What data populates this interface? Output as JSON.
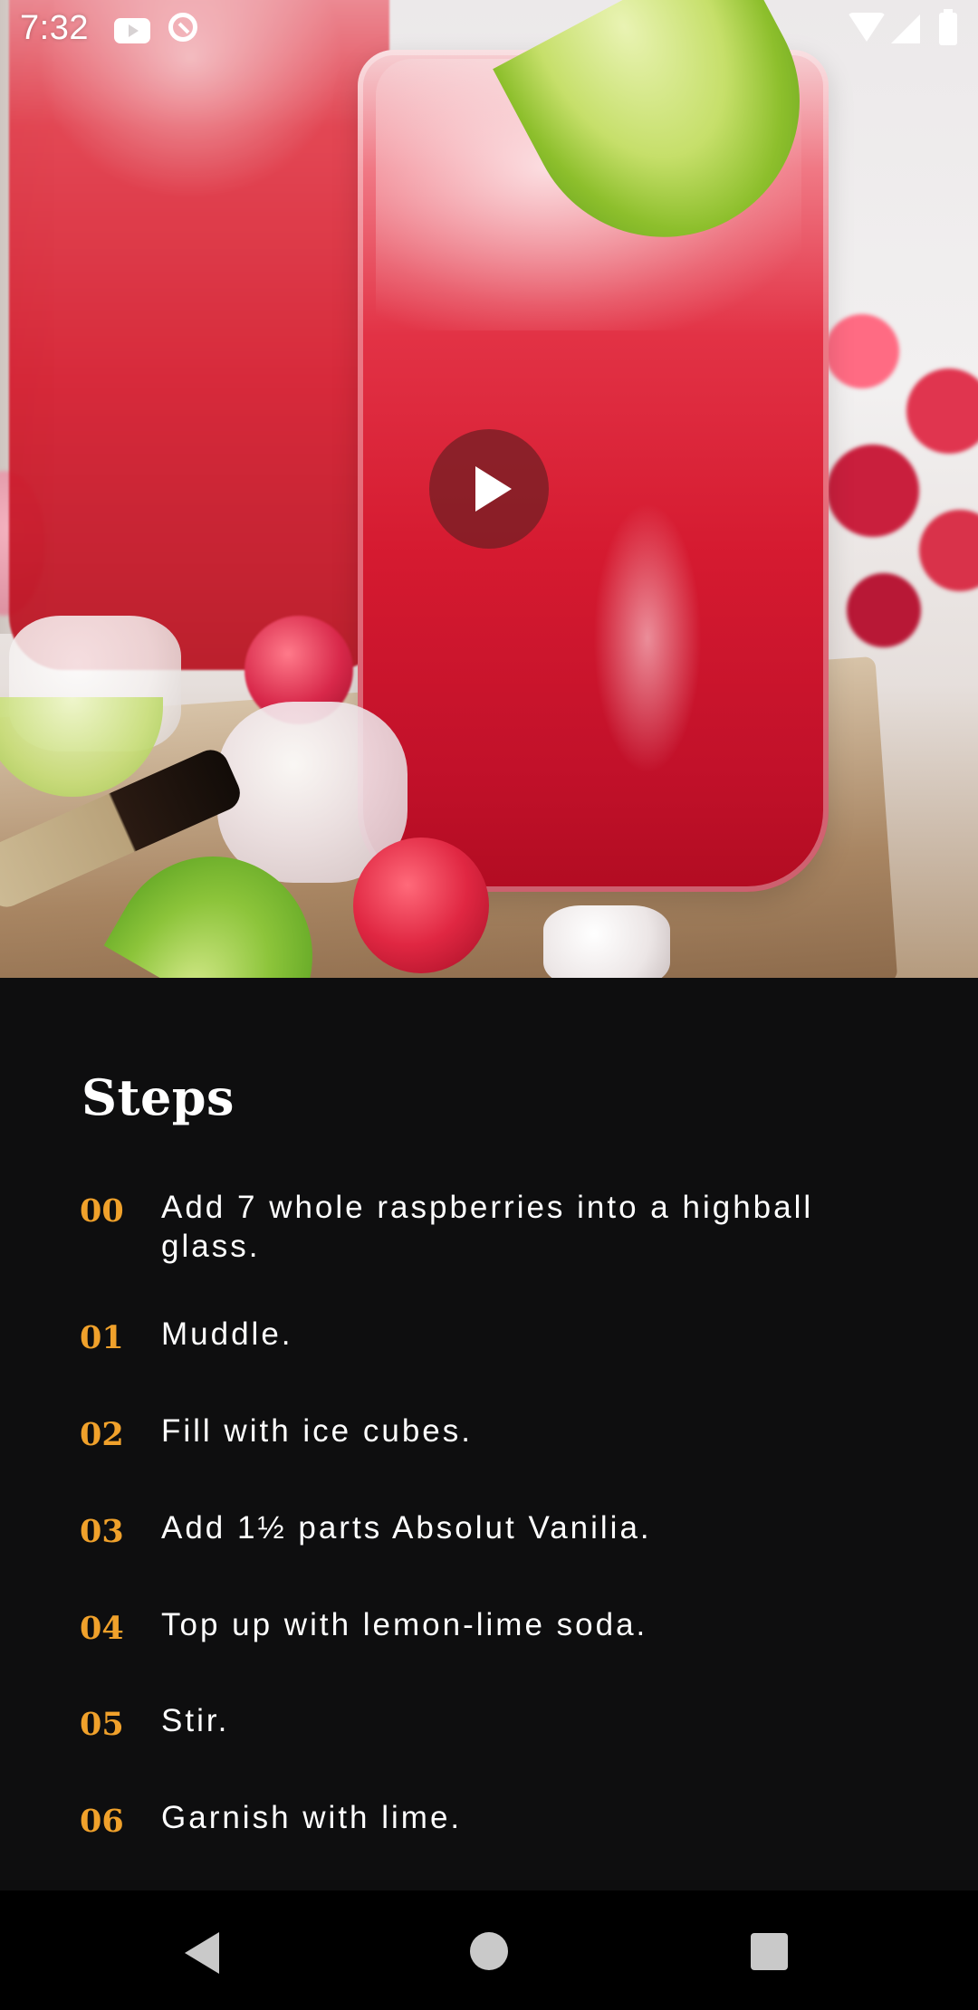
{
  "status_bar": {
    "time": "7:32",
    "icons": [
      "youtube-icon",
      "at-sign-icon",
      "wifi-icon",
      "signal-icon",
      "battery-icon"
    ]
  },
  "hero": {
    "image": "cocktail-photo",
    "play_icon": "play-icon"
  },
  "steps": {
    "title": "Steps",
    "items": [
      {
        "number": "00",
        "text": "Add 7 whole raspberries into a highball glass."
      },
      {
        "number": "01",
        "text": "Muddle."
      },
      {
        "number": "02",
        "text": "Fill with ice cubes."
      },
      {
        "number": "03",
        "text": "Add 1½ parts Absolut Vanilia."
      },
      {
        "number": "04",
        "text": "Top up with lemon-lime soda."
      },
      {
        "number": "05",
        "text": "Stir."
      },
      {
        "number": "06",
        "text": "Garnish with lime."
      }
    ]
  },
  "nav_bar": {
    "icons": [
      "back-icon",
      "home-icon",
      "recents-icon"
    ]
  },
  "colors": {
    "background": "#0e0e0f",
    "step_number": "#f0a12b",
    "text": "#ffffff"
  }
}
